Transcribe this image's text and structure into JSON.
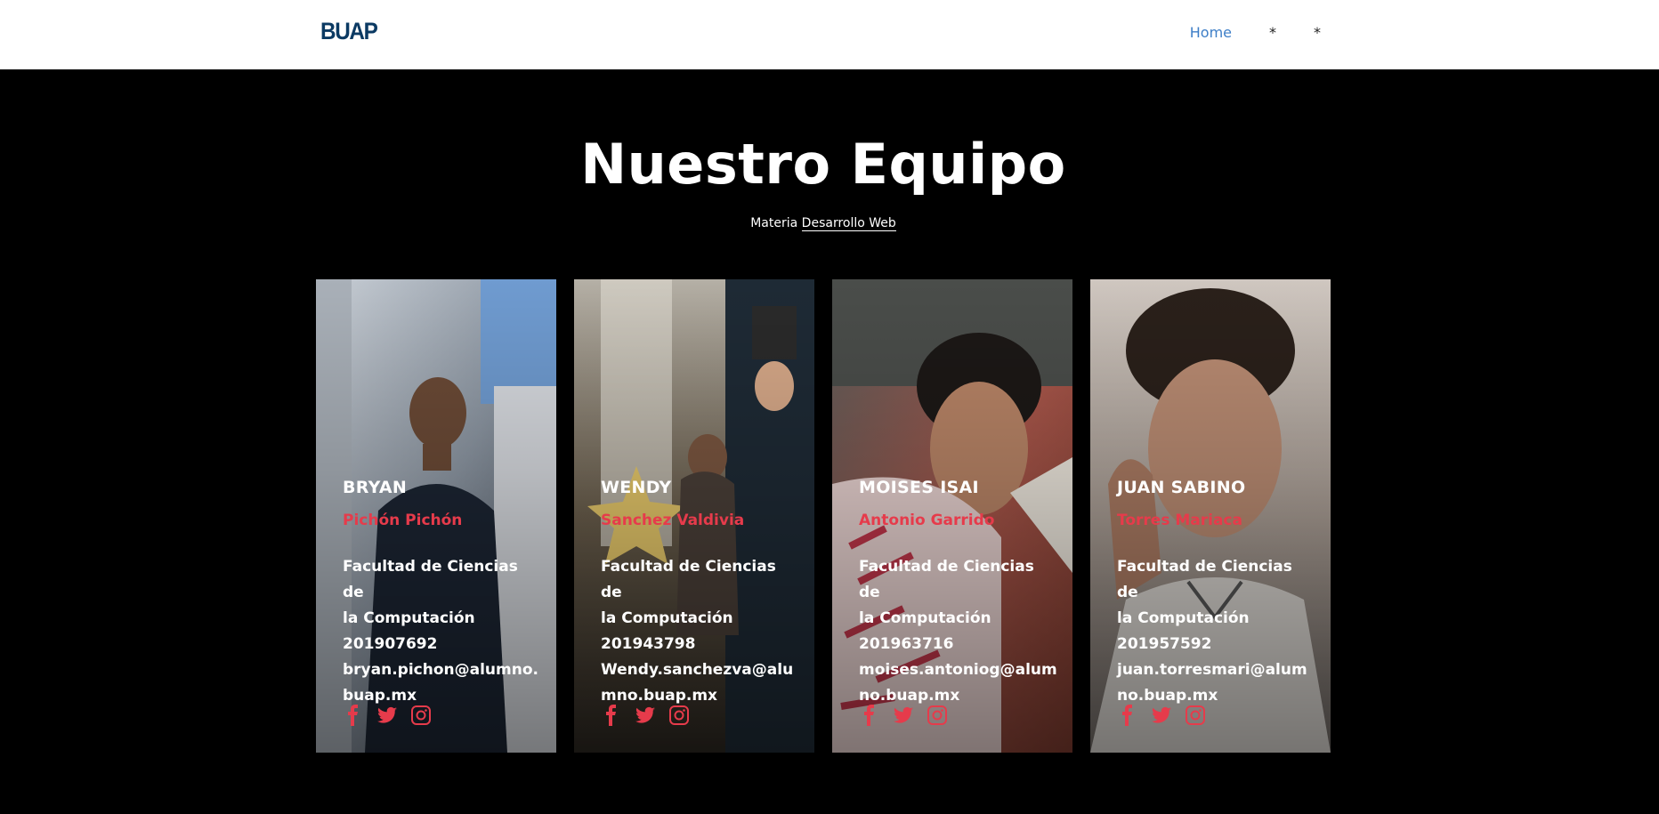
{
  "navbar": {
    "logo": "BUAP",
    "links": [
      "Home",
      "*",
      "*"
    ]
  },
  "hero": {
    "title": "Nuestro Equipo",
    "subtitle_prefix": "Materia",
    "subtitle_link": "Desarrollo Web"
  },
  "team": [
    {
      "first_name": "BRYAN",
      "last_name": "Pichón Pichón",
      "faculty_line1": "Facultad de Ciencias de",
      "faculty_line2": "la Computación",
      "id": "201907692",
      "email": "bryan.pichon@alumno.buap.mx"
    },
    {
      "first_name": "WENDY",
      "last_name": "Sanchez Valdivia",
      "faculty_line1": "Facultad de Ciencias de",
      "faculty_line2": "la Computación",
      "id": "201943798",
      "email": "Wendy.sanchezva@alumno.buap.mx"
    },
    {
      "first_name": "MOISES ISAI",
      "last_name": "Antonio Garrido",
      "faculty_line1": "Facultad de Ciencias de",
      "faculty_line2": "la Computación",
      "id": "201963716",
      "email": "moises.antoniog@alumno.buap.mx"
    },
    {
      "first_name": "JUAN SABINO",
      "last_name": "Torres Mariaca",
      "faculty_line1": "Facultad de Ciencias de",
      "faculty_line2": "la Computación",
      "id": "201957592",
      "email": "juan.torresmari@alumno.buap.mx"
    }
  ],
  "social_icons": [
    "facebook-icon",
    "twitter-icon",
    "instagram-icon"
  ],
  "colors": {
    "accent": "#e63b4b",
    "nav_active": "#3d7ec7",
    "logo": "#0b3a63",
    "background": "#000000"
  }
}
